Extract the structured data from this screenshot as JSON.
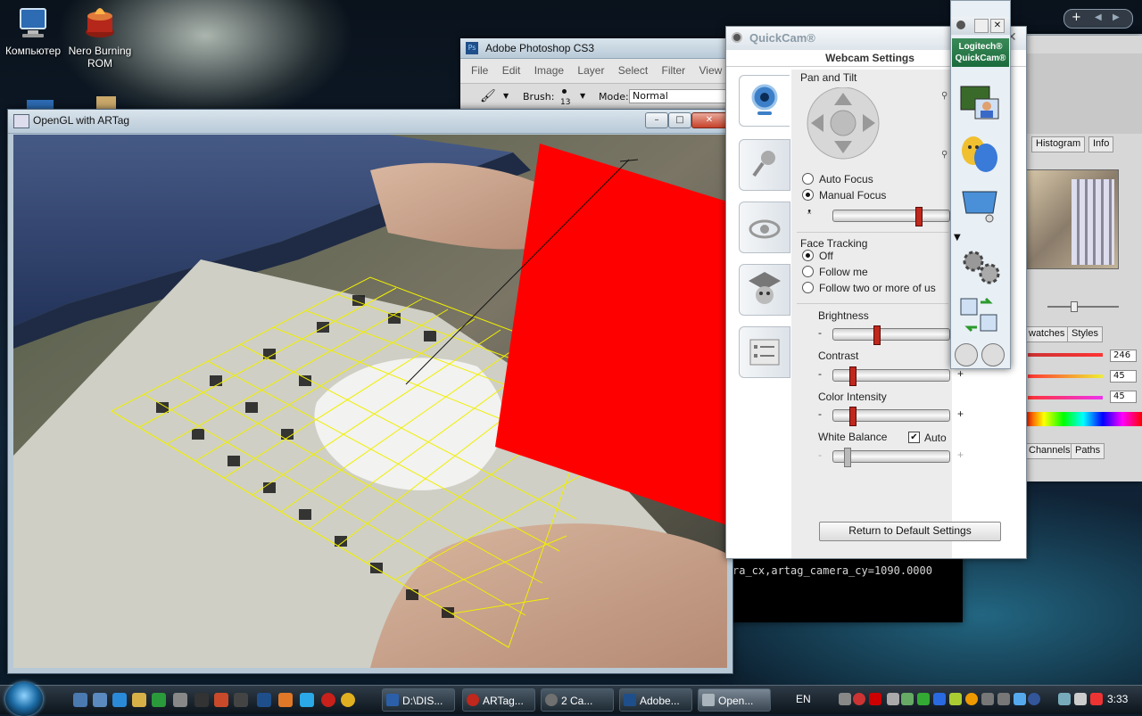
{
  "desktop": {
    "icons": [
      {
        "label": "Компьютер",
        "icon": "computer-icon"
      },
      {
        "label": "Nero Burning ROM",
        "icon": "nero-icon"
      }
    ]
  },
  "opengl_window": {
    "title": "OpenGL with ARTag",
    "min": "–",
    "max": "□",
    "close": "✕"
  },
  "photoshop": {
    "title": "Adobe Photoshop CS3",
    "menu": [
      "File",
      "Edit",
      "Image",
      "Layer",
      "Select",
      "Filter",
      "View"
    ],
    "options": {
      "brush_label": "Brush:",
      "brush_size": "13",
      "mode_label": "Mode:",
      "mode_value": "Normal"
    },
    "panels": {
      "tabs_top": [
        "Histogram",
        "Info"
      ],
      "tabs_mid": [
        "watches",
        "Styles"
      ],
      "color_values": [
        "246",
        "45",
        "45"
      ],
      "tabs_bottom": [
        "Channels",
        "Paths"
      ]
    }
  },
  "quickcam": {
    "title": "QuickCam®",
    "header": "Webcam Settings",
    "pan_tilt_label": "Pan and Tilt",
    "focus": {
      "auto": "Auto Focus",
      "manual": "Manual Focus",
      "selected": "manual",
      "level": 0.75
    },
    "face_tracking": {
      "label": "Face Tracking",
      "options": [
        "Off",
        "Follow me",
        "Follow two or more of us"
      ],
      "selected": 0
    },
    "brightness": {
      "label": "Brightness",
      "level": 0.37
    },
    "contrast": {
      "label": "Contrast",
      "level": 0.15
    },
    "color_intensity": {
      "label": "Color Intensity",
      "level": 0.15
    },
    "white_balance": {
      "label": "White Balance",
      "auto_label": "Auto",
      "auto_checked": true,
      "level": 0.1
    },
    "minus": "-",
    "plus": "+",
    "default_button": "Return to Default Settings",
    "side_tabs": [
      "webcam-icon",
      "microphone-icon",
      "eye-effects-icon",
      "avatar-icon",
      "settings-list-icon"
    ]
  },
  "logitech_bar": {
    "brand_line1": "Logitech®",
    "brand_line2": "QuickCam®",
    "buttons": [
      "video-capture-icon",
      "effects-masks-icon",
      "display-icon",
      "gears-icon",
      "contacts-icon",
      "tools-icon",
      "camera-icon"
    ]
  },
  "console": {
    "line": "ra_cx,artag_camera_cy=1090.0000"
  },
  "taskbar": {
    "tasks": [
      {
        "label": "D:\\DIS...",
        "color": "#2b5fa8"
      },
      {
        "label": "ARTag...",
        "color": "#c0271d"
      },
      {
        "label": "2 Ca...",
        "color": "#707070"
      },
      {
        "label": "Adobe...",
        "color": "#1f4f8a"
      },
      {
        "label": "Open...",
        "color": "#aab4bc"
      }
    ],
    "language": "EN",
    "clock": "3:33"
  }
}
